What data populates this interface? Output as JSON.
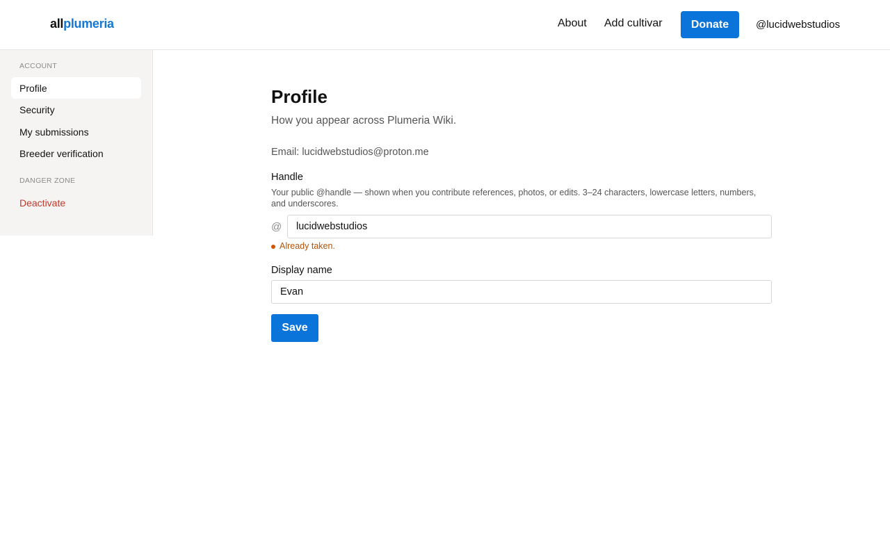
{
  "header": {
    "logo_part1": "all",
    "logo_part2": "plumeria",
    "nav": {
      "about": "About",
      "add_cultivar": "Add cultivar"
    },
    "donate_label": "Donate",
    "user_handle": "@lucidwebstudios"
  },
  "sidebar": {
    "account_heading": "ACCOUNT",
    "items": [
      {
        "label": "Profile",
        "active": true
      },
      {
        "label": "Security"
      },
      {
        "label": "My submissions"
      },
      {
        "label": "Breeder verification"
      }
    ],
    "danger_heading": "DANGER ZONE",
    "danger_item": "Deactivate"
  },
  "main": {
    "title": "Profile",
    "subtitle": "How you appear across Plumeria Wiki.",
    "email_line": "Email: lucidwebstudios@proton.me",
    "handle": {
      "label": "Handle",
      "help": "Your public @handle — shown when you contribute references, photos, or edits. 3–24 characters, lowercase letters, numbers, and underscores.",
      "prefix": "@",
      "value": "lucidwebstudios",
      "error": "Already taken."
    },
    "display_name": {
      "label": "Display name",
      "value": "Evan"
    },
    "save_label": "Save"
  },
  "colors": {
    "accent": "#0a74da",
    "logo_accent": "#1677d2",
    "danger": "#c0392b",
    "error": "#b45309",
    "sidebar_bg": "#f5f4f2"
  }
}
